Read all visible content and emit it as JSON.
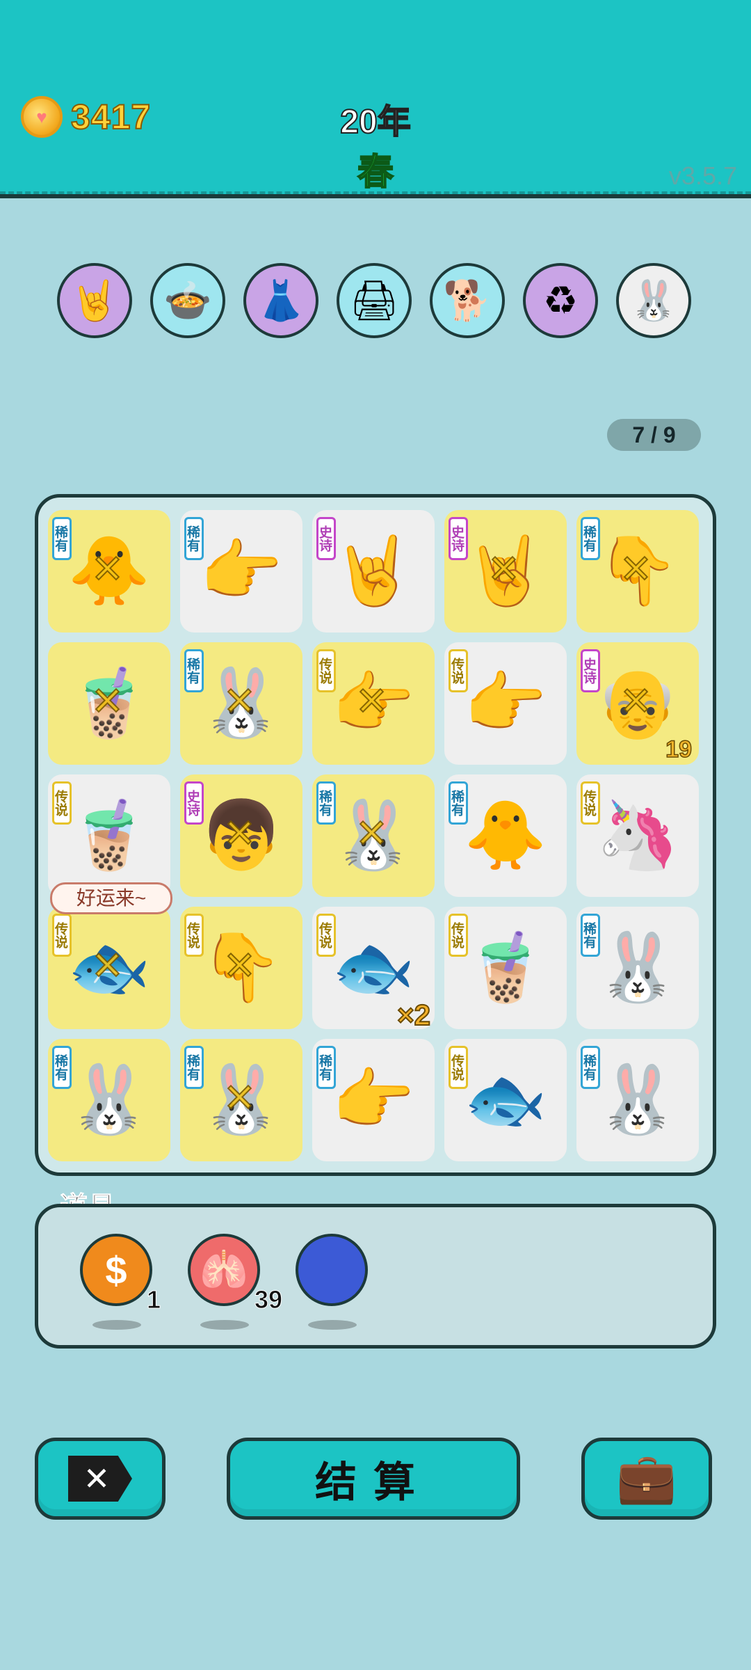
{
  "header": {
    "coins": "3417",
    "year": "20年",
    "season": "春",
    "version": "v3.5.7"
  },
  "skills": [
    {
      "icon": "rock-hand-icon",
      "glyph": "🤘",
      "color": "purple"
    },
    {
      "icon": "chick-pot-icon",
      "glyph": "🍲",
      "color": "cyan"
    },
    {
      "icon": "skirt-icon",
      "glyph": "👗",
      "color": "purple"
    },
    {
      "icon": "printer-warning-icon",
      "glyph": "🖨",
      "color": "cyan"
    },
    {
      "icon": "dog-icon",
      "glyph": "🐕",
      "color": "cyan"
    },
    {
      "icon": "recycle-icon",
      "glyph": "♻",
      "color": "purple"
    },
    {
      "icon": "rabbit-heart-icon",
      "glyph": "🐰",
      "color": "gray"
    }
  ],
  "progress": "7 / 9",
  "tags": {
    "rare": "稀有",
    "epic": "史诗",
    "legend": "传说"
  },
  "board": [
    [
      {
        "tag": "rare",
        "bg": "yellow",
        "symbol": "chick",
        "glyph": "🐥",
        "crossed": true
      },
      {
        "tag": "rare",
        "bg": "white",
        "symbol": "brown-pointing-hand",
        "glyph": "👉"
      },
      {
        "tag": "epic",
        "bg": "white",
        "symbol": "gray-rock-hand",
        "glyph": "🤘"
      },
      {
        "tag": "epic",
        "bg": "yellow",
        "symbol": "gray-rock-hand",
        "glyph": "🤘",
        "crossed": true
      },
      {
        "tag": "rare",
        "bg": "yellow",
        "symbol": "brown-pointing-hand",
        "glyph": "👇",
        "crossed": true
      }
    ],
    [
      {
        "tag": "",
        "bg": "yellow",
        "symbol": "bubble-tea",
        "glyph": "🧋",
        "crossed": true
      },
      {
        "tag": "rare",
        "bg": "yellow",
        "symbol": "rabbit",
        "glyph": "🐰",
        "crossed": true
      },
      {
        "tag": "legend",
        "bg": "yellow",
        "symbol": "yellow-pointing-hand",
        "glyph": "👉",
        "crossed": true
      },
      {
        "tag": "legend",
        "bg": "white",
        "symbol": "yellow-pointing-hand",
        "glyph": "👉"
      },
      {
        "tag": "epic",
        "bg": "yellow",
        "symbol": "green-hair-grandpa",
        "glyph": "👴",
        "crossed": true,
        "count": "19"
      }
    ],
    [
      {
        "tag": "legend",
        "bg": "white",
        "symbol": "bubble-tea",
        "glyph": "🧋"
      },
      {
        "tag": "epic",
        "bg": "yellow",
        "symbol": "red-cap-boy",
        "glyph": "👦",
        "crossed": true
      },
      {
        "tag": "rare",
        "bg": "yellow",
        "symbol": "rabbit",
        "glyph": "🐰",
        "crossed": true
      },
      {
        "tag": "rare",
        "bg": "white",
        "symbol": "chick",
        "glyph": "🐥"
      },
      {
        "tag": "legend",
        "bg": "white",
        "symbol": "unicorn",
        "glyph": "🦄"
      }
    ],
    [
      {
        "tag": "legend",
        "bg": "yellow",
        "symbol": "koi-fish",
        "glyph": "🐟",
        "crossed": true
      },
      {
        "tag": "legend",
        "bg": "yellow",
        "symbol": "yellow-pointing-hand",
        "glyph": "👇",
        "crossed": true
      },
      {
        "tag": "legend",
        "bg": "white",
        "symbol": "koi-fish-star",
        "glyph": "🐟",
        "mult": "×2"
      },
      {
        "tag": "legend",
        "bg": "white",
        "symbol": "bubble-tea",
        "glyph": "🧋"
      },
      {
        "tag": "rare",
        "bg": "white",
        "symbol": "rabbit",
        "glyph": "🐰"
      }
    ],
    [
      {
        "tag": "rare",
        "bg": "yellow",
        "symbol": "rabbit",
        "glyph": "🐰"
      },
      {
        "tag": "rare",
        "bg": "yellow",
        "symbol": "rabbit",
        "glyph": "🐰",
        "crossed": true
      },
      {
        "tag": "rare",
        "bg": "white",
        "symbol": "brown-pointing-hand",
        "glyph": "👉"
      },
      {
        "tag": "legend",
        "bg": "white",
        "symbol": "koi-fish",
        "glyph": "🐟"
      },
      {
        "tag": "rare",
        "bg": "white",
        "symbol": "rabbit",
        "glyph": "🐰"
      }
    ]
  ],
  "bubble": "好运来~",
  "items": {
    "label": "道具",
    "list": [
      {
        "icon": "coin-item-icon",
        "glyph": "$",
        "qty": "1",
        "color": "#f08a1c"
      },
      {
        "icon": "liver-item-icon",
        "glyph": "🫁",
        "qty": "39",
        "color": "#ef6b6b"
      },
      {
        "icon": "blueberry-item-icon",
        "glyph": "",
        "qty": "",
        "color": "#3c5ad6"
      }
    ]
  },
  "buttons": {
    "exit_glyph": "✕",
    "settle": "结算",
    "bag_glyph": "💼"
  }
}
